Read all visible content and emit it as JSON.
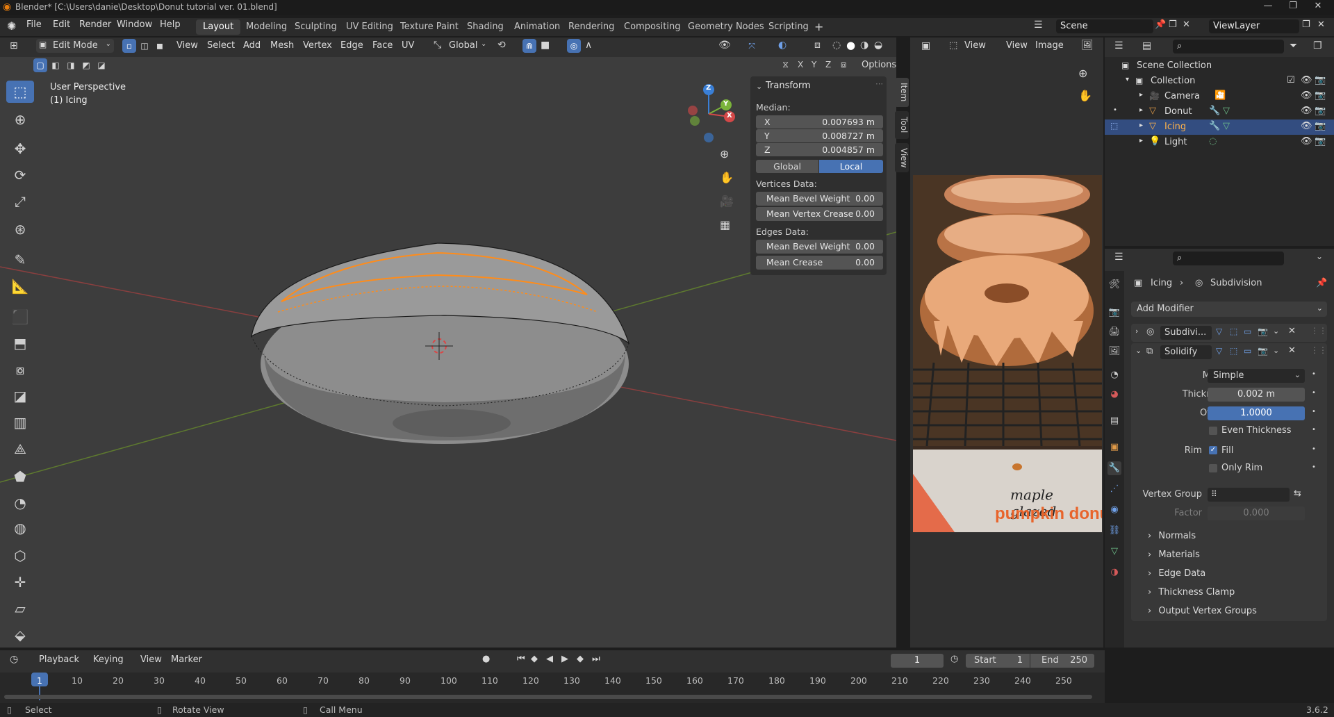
{
  "window": {
    "title": "Blender* [C:\\Users\\danie\\Desktop\\Donut tutorial ver. 01.blend]"
  },
  "menubar": {
    "items": [
      "File",
      "Edit",
      "Render",
      "Window",
      "Help"
    ],
    "workspaces": [
      "Layout",
      "Modeling",
      "Sculpting",
      "UV Editing",
      "Texture Paint",
      "Shading",
      "Animation",
      "Rendering",
      "Compositing",
      "Geometry Nodes",
      "Scripting"
    ],
    "active_workspace": "Layout",
    "add_tab": "+",
    "scene": "Scene",
    "view_layer": "ViewLayer"
  },
  "viewport_header": {
    "mode": "Edit Mode",
    "menus": [
      "View",
      "Select",
      "Add",
      "Mesh",
      "Vertex",
      "Edge",
      "Face",
      "UV"
    ],
    "orientation": "Global",
    "axes": [
      "X",
      "Y",
      "Z"
    ],
    "options": "Options"
  },
  "viewport": {
    "view_name": "User Perspective",
    "object_name": "(1) Icing",
    "gizmo_axes": [
      "Z",
      "Y",
      "X"
    ]
  },
  "npanel": {
    "section": "Transform",
    "median_label": "Median:",
    "coords": [
      {
        "axis": "X",
        "value": "0.007693 m"
      },
      {
        "axis": "Y",
        "value": "0.008727 m"
      },
      {
        "axis": "Z",
        "value": "0.004857 m"
      }
    ],
    "space_global": "Global",
    "space_local": "Local",
    "vertices_label": "Vertices Data:",
    "vertices": [
      {
        "label": "Mean Bevel Weight",
        "value": "0.00"
      },
      {
        "label": "Mean Vertex Crease",
        "value": "0.00"
      }
    ],
    "edges_label": "Edges Data:",
    "edges": [
      {
        "label": "Mean Bevel Weight",
        "value": "0.00"
      },
      {
        "label": "Mean Crease",
        "value": "0.00"
      }
    ],
    "tabs": [
      "Item",
      "Tool",
      "View"
    ]
  },
  "image_editor": {
    "menus": [
      "View",
      "View",
      "Image"
    ],
    "caption_line1": "maple glazed",
    "caption_line2": "pumpkin donu"
  },
  "outliner": {
    "rows": [
      {
        "label": "Scene Collection"
      },
      {
        "label": "Collection"
      },
      {
        "label": "Camera"
      },
      {
        "label": "Donut"
      },
      {
        "label": "Icing"
      },
      {
        "label": "Light"
      }
    ]
  },
  "properties": {
    "breadcrumb_object": "Icing",
    "breadcrumb_modifier": "Subdivision",
    "add_modifier": "Add Modifier",
    "modifiers": [
      {
        "name": "Subdivi...",
        "expanded": false
      },
      {
        "name": "Solidify",
        "expanded": true
      }
    ],
    "fields": {
      "mode_label": "Mode",
      "mode_value": "Simple",
      "thickness_label": "Thickness",
      "thickness_value": "0.002 m",
      "offset_label": "Offset",
      "offset_value": "1.0000",
      "even_thickness": "Even Thickness",
      "rim_label": "Rim",
      "fill": "Fill",
      "only_rim": "Only Rim",
      "vertex_group_label": "Vertex Group",
      "factor_label": "Factor",
      "factor_value": "0.000"
    },
    "subpanels": [
      "Normals",
      "Materials",
      "Edge Data",
      "Thickness Clamp",
      "Output Vertex Groups"
    ]
  },
  "timeline": {
    "menus": [
      "Playback",
      "Keying",
      "View",
      "Marker"
    ],
    "current_frame": "1",
    "start_label": "Start",
    "start_value": "1",
    "end_label": "End",
    "end_value": "250",
    "ruler": [
      "1",
      "10",
      "20",
      "30",
      "40",
      "50",
      "60",
      "70",
      "80",
      "90",
      "100",
      "110",
      "120",
      "130",
      "140",
      "150",
      "160",
      "170",
      "180",
      "190",
      "200",
      "210",
      "220",
      "230",
      "240",
      "250"
    ]
  },
  "statusbar": {
    "select": "Select",
    "rotate": "Rotate View",
    "call_menu": "Call Menu",
    "version": "3.6.2"
  },
  "colors": {
    "accent": "#4772b3",
    "selection_orange": "#ff8c1a",
    "outliner_selected": "#334d80"
  }
}
